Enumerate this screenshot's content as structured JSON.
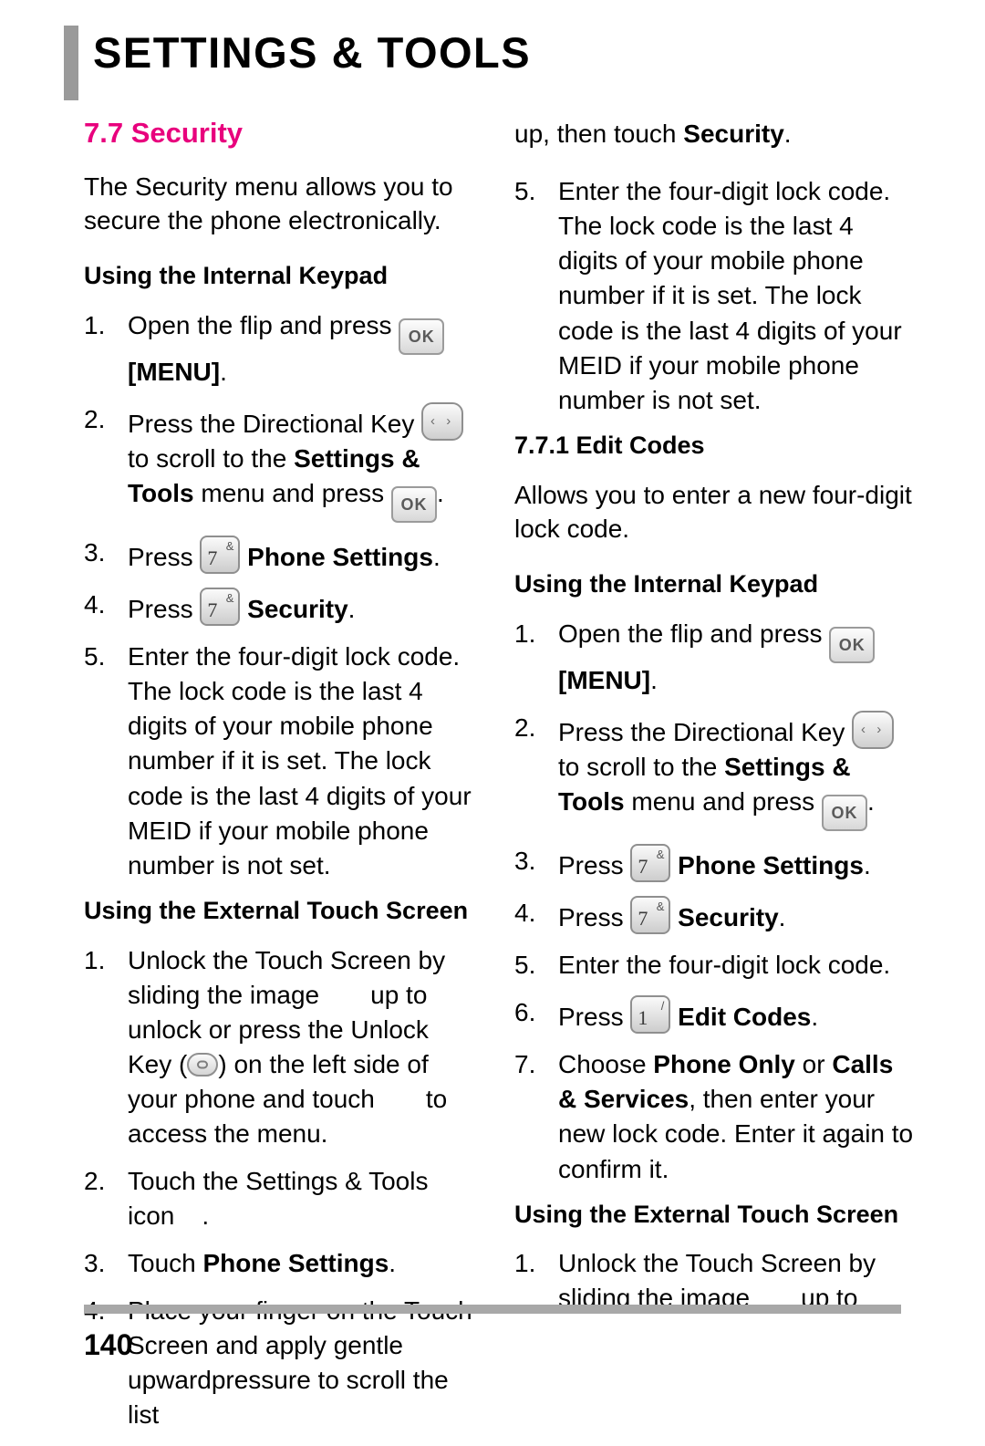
{
  "header": {
    "title": "SETTINGS & TOOLS"
  },
  "left": {
    "section_number_title": "7.7 Security",
    "intro": "The Security menu allows you to secure the phone electronically.",
    "internal_keypad_heading": "Using the Internal Keypad",
    "steps_internal": [
      {
        "num": "1.",
        "text_before": "Open the flip and press ",
        "icon": "ok-key",
        "text_after": "",
        "bold_tail": "[MENU]",
        "tail_punct": "."
      },
      {
        "num": "2.",
        "text_before": "Press the Directional Key ",
        "icon": "directional-key",
        "text_after": " to scroll to the ",
        "bold_mid": "Settings & Tools",
        "text_after2": " menu and press ",
        "icon2": "ok-key",
        "tail_punct": "."
      },
      {
        "num": "3.",
        "text_before": "Press ",
        "icon": "num-7-key",
        "bold_tail": "Phone Settings",
        "tail_punct": "."
      },
      {
        "num": "4.",
        "text_before": "Press ",
        "icon": "num-7-key",
        "bold_tail": "Security",
        "tail_punct": "."
      },
      {
        "num": "5.",
        "text_before": "Enter the four-digit lock code. The lock code is the last 4 digits of your mobile phone number if it is set. The lock code is the last 4 digits of your MEID if your mobile phone number is not set."
      }
    ],
    "touch_screen_heading": "Using the External Touch Screen",
    "steps_touch": [
      {
        "num": "1.",
        "part1": "Unlock the Touch Screen by sliding the image",
        "part2": "up to unlock or press the Unlock Key (",
        "icon": "unlock-key",
        "part3": ") on the left side of your phone and touch",
        "part4": "to access the menu."
      },
      {
        "num": "2.",
        "part1": "Touch the Settings & Tools icon",
        "part2": "."
      },
      {
        "num": "3.",
        "text_before": "Touch ",
        "bold_tail": "Phone Settings",
        "tail_punct": "."
      },
      {
        "num": "4.",
        "part1": "Place your finger on the Touch Screen and apply gentle upwardpressure to scroll the list"
      }
    ]
  },
  "right": {
    "continued_line_before": "up, then touch ",
    "continued_bold": "Security",
    "continued_punct": ".",
    "step5_num": "5.",
    "step5_text": "Enter the four-digit lock code. The lock code is the last 4 digits of your mobile phone number if it is set. The lock code is the last 4 digits of your MEID if your mobile phone number is not set.",
    "edit_codes_heading": "7.7.1 Edit Codes",
    "edit_codes_intro": "Allows you to enter a new four-digit lock code.",
    "internal_keypad_heading": "Using the Internal Keypad",
    "steps_internal": [
      {
        "num": "1.",
        "text_before": "Open the flip and press ",
        "icon": "ok-key",
        "bold_tail": "[MENU]",
        "tail_punct": "."
      },
      {
        "num": "2.",
        "text_before": "Press the Directional Key ",
        "icon": "directional-key",
        "text_after": " to scroll to the ",
        "bold_mid": "Settings & Tools",
        "text_after2": " menu and press ",
        "icon2": "ok-key",
        "tail_punct": "."
      },
      {
        "num": "3.",
        "text_before": "Press ",
        "icon": "num-7-key",
        "bold_tail": "Phone Settings",
        "tail_punct": "."
      },
      {
        "num": "4.",
        "text_before": "Press ",
        "icon": "num-7-key",
        "bold_tail": "Security",
        "tail_punct": "."
      },
      {
        "num": "5.",
        "text_before": "Enter the four-digit lock code."
      },
      {
        "num": "6.",
        "text_before": "Press ",
        "icon": "num-1-key",
        "bold_tail": "Edit Codes",
        "tail_punct": "."
      },
      {
        "num": "7.",
        "text_before": "Choose ",
        "bold_a": "Phone Only",
        "text_mid": " or ",
        "bold_b": "Calls & Services",
        "text_after": ", then enter your new lock code. Enter it again to confirm it."
      }
    ],
    "touch_screen_heading": "Using the External Touch Screen",
    "steps_touch": [
      {
        "num": "1.",
        "part1": "Unlock the Touch Screen by sliding the image",
        "part2": "up to"
      }
    ]
  },
  "keys": {
    "ok_label": "OK",
    "dir_arrows": "‹ ›",
    "num7_digit": "7",
    "num7_sub": "&",
    "num1_digit": "1",
    "num1_sub": "/"
  },
  "footer": {
    "page_number": "140"
  },
  "colors": {
    "accent": "#e8007d",
    "rule": "#a8a8a8",
    "header_bar": "#9a9a9a"
  }
}
